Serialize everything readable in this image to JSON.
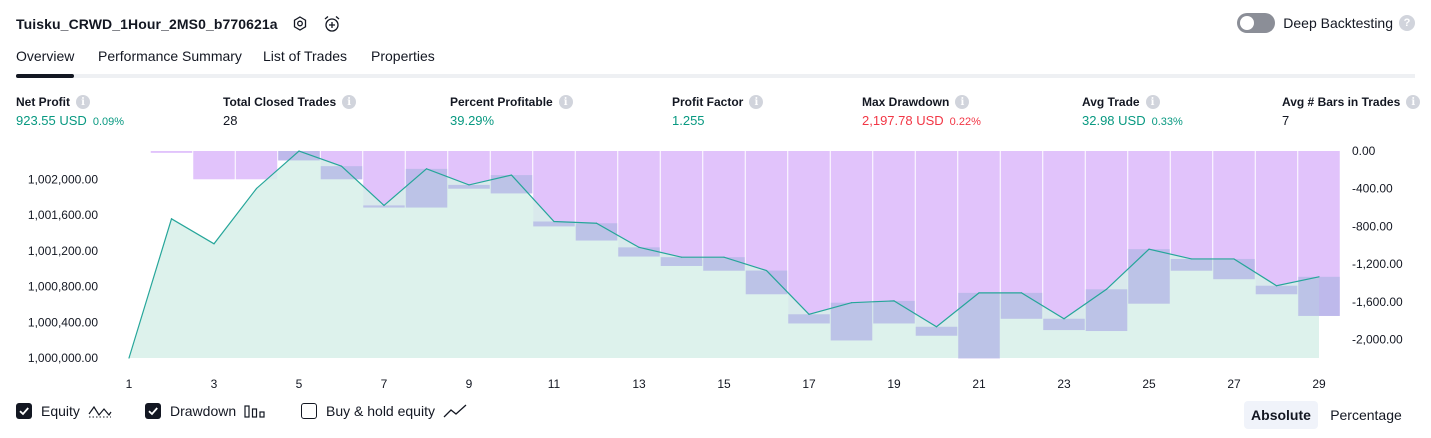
{
  "header": {
    "title": "Tuisku_CRWD_1Hour_2MS0_b770621a",
    "settings_icon": "gear-icon",
    "alert_icon": "alarm-add-icon"
  },
  "deep_backtesting": {
    "label": "Deep Backtesting",
    "enabled": false,
    "help": "?"
  },
  "tabs": [
    {
      "label": "Overview",
      "active": true
    },
    {
      "label": "Performance Summary",
      "active": false
    },
    {
      "label": "List of Trades",
      "active": false
    },
    {
      "label": "Properties",
      "active": false
    }
  ],
  "metrics": [
    {
      "label": "Net Profit",
      "value": "923.55 USD",
      "pct": "0.09%",
      "color": "green"
    },
    {
      "label": "Total Closed Trades",
      "value": "28",
      "pct": "",
      "color": "dark"
    },
    {
      "label": "Percent Profitable",
      "value": "39.29%",
      "pct": "",
      "color": "green"
    },
    {
      "label": "Profit Factor",
      "value": "1.255",
      "pct": "",
      "color": "green"
    },
    {
      "label": "Max Drawdown",
      "value": "2,197.78 USD",
      "pct": "0.22%",
      "color": "red"
    },
    {
      "label": "Avg Trade",
      "value": "32.98 USD",
      "pct": "0.33%",
      "color": "green"
    },
    {
      "label": "Avg # Bars in Trades",
      "value": "7",
      "pct": "",
      "color": "dark"
    }
  ],
  "info_glyph": "i",
  "chart_data": {
    "type": "area",
    "x": [
      1,
      2,
      3,
      4,
      5,
      6,
      7,
      8,
      9,
      10,
      11,
      12,
      13,
      14,
      15,
      16,
      17,
      18,
      19,
      20,
      21,
      22,
      23,
      24,
      25,
      26,
      27,
      28,
      29
    ],
    "x_tick_labels": [
      "1",
      "3",
      "5",
      "7",
      "9",
      "11",
      "13",
      "15",
      "17",
      "19",
      "21",
      "23",
      "25",
      "27",
      "29"
    ],
    "equity": [
      1000000,
      1001560,
      1001280,
      1001900,
      1002320,
      1002150,
      1001710,
      1002120,
      1001940,
      1002050,
      1001530,
      1001510,
      1001240,
      1001130,
      1001130,
      1000980,
      1000490,
      1000620,
      1000640,
      1000350,
      1000730,
      1000730,
      1000440,
      1000770,
      1001220,
      1001110,
      1001110,
      1000810,
      1000910
    ],
    "drawdown": [
      0,
      -20,
      -300,
      -300,
      -100,
      -300,
      -600,
      -600,
      -400,
      -450,
      -800,
      -950,
      -1120,
      -1220,
      -1270,
      -1520,
      -1830,
      -2010,
      -1830,
      -1960,
      -2200,
      -1780,
      -1900,
      -1910,
      -1620,
      -1270,
      -1360,
      -1520,
      -1750
    ],
    "left_axis": {
      "ticks": [
        "1,002,000.00",
        "1,001,600.00",
        "1,001,200.00",
        "1,000,800.00",
        "1,000,400.00",
        "1,000,000.00"
      ],
      "range": [
        1000000,
        1002320
      ]
    },
    "right_axis": {
      "ticks": [
        "0.00",
        "-400.00",
        "-800.00",
        "-1,200.00",
        "-1,600.00",
        "-2,000.00"
      ],
      "range": [
        -2200,
        0
      ]
    },
    "colors": {
      "equity_line": "#26a69a",
      "equity_fill": "#d7f0e9",
      "drawdown_bar": "#e1c3fb",
      "overlap": "#b1b5e5"
    }
  },
  "legend": [
    {
      "label": "Equity",
      "checked": true,
      "icon": "equity-wave-icon"
    },
    {
      "label": "Drawdown",
      "checked": true,
      "icon": "drawdown-bars-icon"
    },
    {
      "label": "Buy & hold equity",
      "checked": false,
      "icon": "trend-line-icon"
    }
  ],
  "modes": [
    {
      "label": "Absolute",
      "active": true
    },
    {
      "label": "Percentage",
      "active": false
    }
  ]
}
